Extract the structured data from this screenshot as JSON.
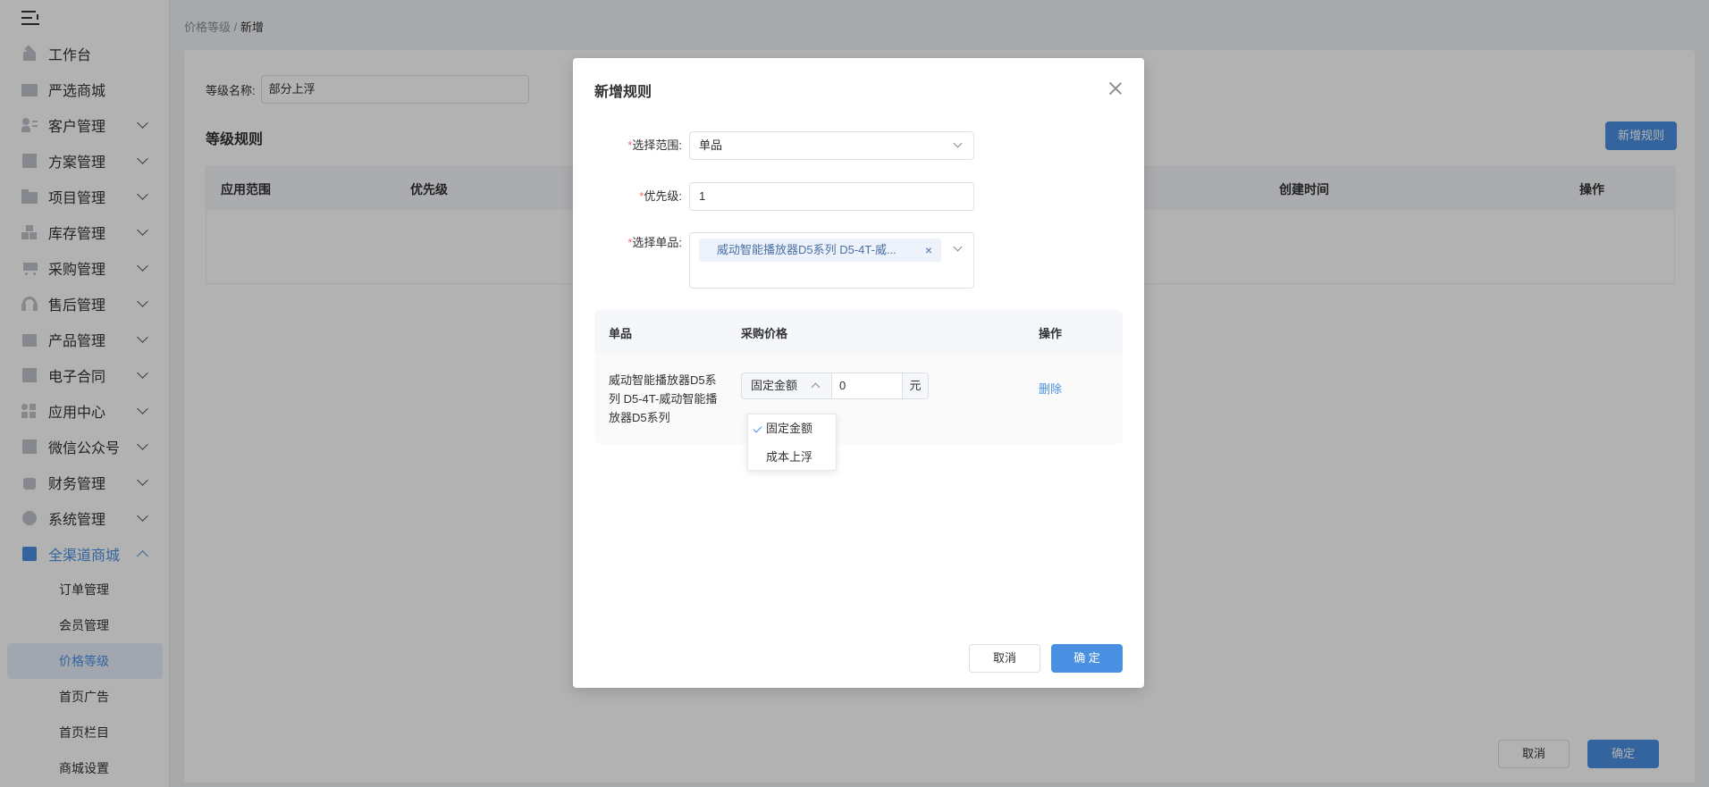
{
  "sidebar": {
    "items": [
      {
        "label": "工作台",
        "icon": "home-icon",
        "expandable": false
      },
      {
        "label": "严选商城",
        "icon": "chart-icon",
        "expandable": false
      },
      {
        "label": "客户管理",
        "icon": "users-icon",
        "expandable": true
      },
      {
        "label": "方案管理",
        "icon": "document-icon",
        "expandable": true
      },
      {
        "label": "项目管理",
        "icon": "folder-icon",
        "expandable": true
      },
      {
        "label": "库存管理",
        "icon": "boxes-icon",
        "expandable": true
      },
      {
        "label": "采购管理",
        "icon": "cart-icon",
        "expandable": true
      },
      {
        "label": "售后管理",
        "icon": "headset-icon",
        "expandable": true
      },
      {
        "label": "产品管理",
        "icon": "product-icon",
        "expandable": true
      },
      {
        "label": "电子合同",
        "icon": "contract-icon",
        "expandable": true
      },
      {
        "label": "应用中心",
        "icon": "apps-icon",
        "expandable": true
      },
      {
        "label": "微信公众号",
        "icon": "wechat-icon",
        "expandable": true
      },
      {
        "label": "财务管理",
        "icon": "finance-icon",
        "expandable": true
      },
      {
        "label": "系统管理",
        "icon": "settings-icon",
        "expandable": true
      },
      {
        "label": "全渠道商城",
        "icon": "mall-icon",
        "expandable": true,
        "expanded": true,
        "active": true
      }
    ],
    "sub_items": [
      "订单管理",
      "会员管理",
      "价格等级",
      "首页广告",
      "首页栏目",
      "商城设置"
    ],
    "active_sub": "价格等级"
  },
  "breadcrumb": {
    "parent": "价格等级",
    "separator": "/",
    "current": "新增"
  },
  "form": {
    "name_label": "等级名称:",
    "name_value": "部分上浮"
  },
  "rules": {
    "title": "等级规则",
    "add_button": "新增规则",
    "columns": [
      "应用范围",
      "优先级",
      "创建时间",
      "操作"
    ]
  },
  "footer": {
    "cancel": "取消",
    "confirm": "确定"
  },
  "dialog": {
    "title": "新增规则",
    "scope_label": "选择范围",
    "scope_value": "单品",
    "priority_label": "优先级",
    "priority_value": "1",
    "item_label": "选择单品",
    "item_tag": "威动智能播放器D5系列 D5-4T-威...",
    "table": {
      "columns": [
        "单品",
        "采购价格",
        "操作"
      ],
      "row": {
        "name": "威动智能播放器D5系列 D5-4T-威动智能播放器D5系列",
        "price_type": "固定金额",
        "price_value": "0",
        "unit": "元",
        "action": "删除"
      }
    },
    "price_options": [
      "固定金额",
      "成本上浮"
    ],
    "selected_option": "固定金额",
    "cancel": "取消",
    "confirm": "确 定"
  },
  "colors": {
    "primary": "#4a90e2",
    "required": "#f56c6c"
  }
}
